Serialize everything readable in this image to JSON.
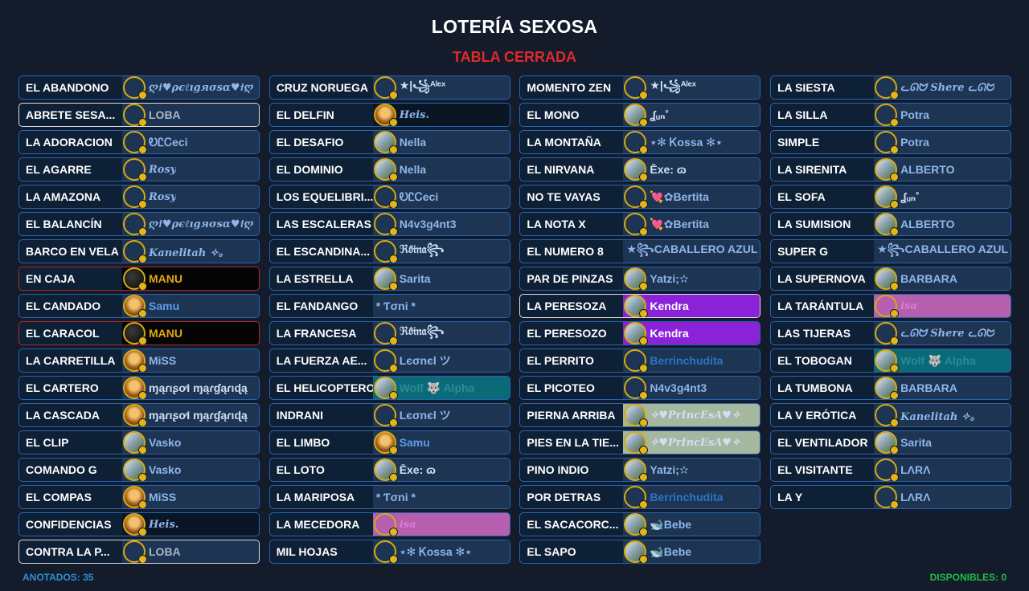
{
  "header": {
    "title": "LOTERÍA SEXOSA",
    "subtitle": "TABLA CERRADA"
  },
  "colors": {
    "accent_red": "#e02a2a",
    "count_blue": "#2d8fd6",
    "count_green": "#1fbf4a",
    "card_border": "#2266b8"
  },
  "columns": [
    [
      {
        "card": "EL ABANDONO",
        "user": "ღϯ♥ρєℓıgяσѕα♥ϯღ",
        "av": "ring",
        "style": "it",
        "bg": "#1d3552",
        "color": "#8fb6ec"
      },
      {
        "card": "ABRETE SESA...",
        "user": "LOBA",
        "av": "ring",
        "border": "white",
        "bg": "#1d3552",
        "color": "#a9b6c8"
      },
      {
        "card": "LA ADORACION",
        "user": "ᎧᏝᏟeci",
        "av": "ring",
        "bg": "#1d3552",
        "color": "#8fb6ec"
      },
      {
        "card": "EL AGARRE",
        "user": "Rosy",
        "av": "ring",
        "style": "it",
        "bg": "#1d3552",
        "color": "#8fb6ec"
      },
      {
        "card": "LA AMAZONA",
        "user": "Rosy",
        "av": "ring",
        "style": "it",
        "bg": "#1d3552",
        "color": "#8fb6ec"
      },
      {
        "card": "EL BALANCÍN",
        "user": "ღϯ♥ρєℓıgяσѕα♥ϯღ",
        "av": "ring",
        "style": "it",
        "bg": "#1d3552",
        "color": "#8fb6ec"
      },
      {
        "card": "BARCO EN VELA",
        "user": "Kanelitah ✧。",
        "av": "ring",
        "style": "it",
        "bg": "#1d3552",
        "color": "#8fb6ec"
      },
      {
        "card": "EN CAJA",
        "user": "MANU",
        "av": "dark",
        "border": "red",
        "bg": "#050505",
        "color": "#e4a712"
      },
      {
        "card": "EL CANDADO",
        "user": "Samu",
        "av": "photo",
        "bg": "#1d3552",
        "color": "#5f9de8"
      },
      {
        "card": "EL CARACOL",
        "user": "MANU",
        "av": "dark",
        "border": "red",
        "bg": "#050505",
        "color": "#e4a712"
      },
      {
        "card": "LA CARRETILLA",
        "user": "MiSS",
        "av": "photo",
        "bg": "#1d3552",
        "color": "#8fb6ec"
      },
      {
        "card": "EL CARTERO",
        "user": "ɱąɾıʂơƖ ɱąɾɠąɾıɖą",
        "av": "photo",
        "bg": "#1d3552",
        "color": "#cfe0f5"
      },
      {
        "card": "LA CASCADA",
        "user": "ɱąɾıʂơƖ ɱąɾɠąɾıɖą",
        "av": "photo",
        "bg": "#1d3552",
        "color": "#cfe0f5"
      },
      {
        "card": "EL CLIP",
        "user": "Vasko",
        "av": "img",
        "bg": "#1d3552",
        "color": "#8fb6ec"
      },
      {
        "card": "COMANDO G",
        "user": "Vasko",
        "av": "img",
        "bg": "#1d3552",
        "color": "#8fb6ec"
      },
      {
        "card": "EL COMPAS",
        "user": "MiSS",
        "av": "photo",
        "bg": "#1d3552",
        "color": "#8fb6ec"
      },
      {
        "card": "CONFIDENCIAS",
        "user": "Heis.",
        "av": "photo",
        "style": "it",
        "bg": "#0a1624",
        "color": "#8fb6ec"
      },
      {
        "card": "CONTRA LA P...",
        "user": "LOBA",
        "av": "ring",
        "border": "white",
        "bg": "#1d3552",
        "color": "#a9b6c8"
      }
    ],
    [
      {
        "card": "CRUZ NORUEGA",
        "user": "★|꧁ᴬˡᵉˣ",
        "av": "ring",
        "bg": "#1d3552",
        "color": "#cfe0f5"
      },
      {
        "card": "EL DELFIN",
        "user": "Heis.",
        "av": "photo",
        "style": "it",
        "bg": "#0a1624",
        "color": "#8fb6ec"
      },
      {
        "card": "EL DESAFIO",
        "user": "Nella",
        "av": "img",
        "bg": "#1d3552",
        "color": "#8fb6ec"
      },
      {
        "card": "EL DOMINIO",
        "user": "Nella",
        "av": "img",
        "bg": "#1d3552",
        "color": "#8fb6ec"
      },
      {
        "card": "LOS EQUELIBRI...",
        "user": "ᎧᏝᏟeci",
        "av": "ring",
        "bg": "#1d3552",
        "color": "#8fb6ec"
      },
      {
        "card": "LAS ESCALERAS",
        "user": "N4v3g4nt3",
        "av": "ring",
        "bg": "#1d3552",
        "color": "#8fb6ec"
      },
      {
        "card": "EL ESCANDINA...",
        "user": "ℜ𝔬̂𝔦𝔫𝔞꧂",
        "av": "ring",
        "bg": "#1d3552",
        "color": "#cfe0f5"
      },
      {
        "card": "LA ESTRELLA",
        "user": "Sarita",
        "av": "img",
        "bg": "#1d3552",
        "color": "#8fb6ec"
      },
      {
        "card": "EL FANDANGO",
        "user": "* Ƭσni *",
        "av": "none",
        "bg": "#1d3552",
        "color": "#8fb6ec"
      },
      {
        "card": "LA FRANCESA",
        "user": "ℜ𝔬̂𝔦𝔫𝔞꧂",
        "av": "ring",
        "bg": "#1d3552",
        "color": "#cfe0f5"
      },
      {
        "card": "LA FUERZA AE...",
        "user": "Lєσnєl    ツ",
        "av": "ring",
        "bg": "#1d3552",
        "color": "#8fb6ec"
      },
      {
        "card": "EL HELICOPTERO",
        "user": "Wolf 🐺 Alpha",
        "av": "img",
        "bg": "#0b6a78",
        "color": "#2a8a97"
      },
      {
        "card": "INDRANI",
        "user": "Lєσnєl    ツ",
        "av": "ring",
        "bg": "#1d3552",
        "color": "#8fb6ec"
      },
      {
        "card": "EL LIMBO",
        "user": "Samu",
        "av": "photo",
        "bg": "#1d3552",
        "color": "#5f9de8"
      },
      {
        "card": "EL LOTO",
        "user": "Ēxe: ɷ",
        "av": "img",
        "bg": "#1d3552",
        "color": "#cfe0f5"
      },
      {
        "card": "LA MARIPOSA",
        "user": "* Ƭσni *",
        "av": "none",
        "bg": "#1d3552",
        "color": "#8fb6ec"
      },
      {
        "card": "LA MECEDORA",
        "user": "isa",
        "av": "ring",
        "style": "it",
        "bg": "#b65fae",
        "color": "#e07ad6"
      },
      {
        "card": "MIL HOJAS",
        "user": "⋆✻ Ꮶossa ✻⋆",
        "av": "ring",
        "bg": "#1d3552",
        "color": "#8fb6ec"
      }
    ],
    [
      {
        "card": "MOMENTO ZEN",
        "user": "★|꧁ᴬˡᵉˣ",
        "av": "ring",
        "bg": "#1d3552",
        "color": "#cfe0f5"
      },
      {
        "card": "EL MONO",
        "user": "ʆᵤₙ˚",
        "av": "img",
        "bg": "#1d3552",
        "color": "#cfe0f5"
      },
      {
        "card": "LA MONTAÑA",
        "user": "⋆✻ Ꮶossa ✻⋆",
        "av": "ring",
        "bg": "#1d3552",
        "color": "#8fb6ec"
      },
      {
        "card": "EL NIRVANA",
        "user": "Ēxe: ɷ",
        "av": "img",
        "bg": "#1d3552",
        "color": "#cfe0f5"
      },
      {
        "card": "NO TE VAYAS",
        "user": "💘✿Bertita",
        "av": "ring",
        "bg": "#1d3552",
        "color": "#8fb6ec"
      },
      {
        "card": "LA NOTA X",
        "user": "💘✿Bertita",
        "av": "ring",
        "bg": "#1d3552",
        "color": "#8fb6ec"
      },
      {
        "card": "EL NUMERO 8",
        "user": "★꧂CABALLERO AZUL",
        "av": "none",
        "bg": "#1d3552",
        "color": "#8fb6ec"
      },
      {
        "card": "PAR DE PINZAS",
        "user": "Yatzi;✫",
        "av": "img",
        "bg": "#1d3552",
        "color": "#8fb6ec"
      },
      {
        "card": "LA PERESOZA",
        "user": "Kendra",
        "av": "img",
        "border": "white",
        "bg": "#8a22d8",
        "color": "#ffffff"
      },
      {
        "card": "EL PERESOZO",
        "user": "Kendra",
        "av": "img",
        "bg": "#8a22d8",
        "color": "#ffffff"
      },
      {
        "card": "EL PERRITO",
        "user": "Berrinchudita",
        "av": "ring",
        "bg": "#1d3552",
        "color": "#2d73c8"
      },
      {
        "card": "EL PICOTEO",
        "user": "N4v3g4nt3",
        "av": "ring",
        "bg": "#1d3552",
        "color": "#8fb6ec"
      },
      {
        "card": "PIERNA ARRIBA",
        "user": "✧♥PrIncEsA♥✧",
        "av": "img",
        "style": "it",
        "bg": "#a6b7a0",
        "color": "#cfe0f5"
      },
      {
        "card": "PIES EN LA TIE...",
        "user": "✧♥PrIncEsA♥✧",
        "av": "img",
        "style": "it",
        "bg": "#a6b7a0",
        "color": "#cfe0f5"
      },
      {
        "card": "PINO INDIO",
        "user": "Yatzi;✫",
        "av": "img",
        "bg": "#1d3552",
        "color": "#8fb6ec"
      },
      {
        "card": "POR DETRAS",
        "user": "Berrinchudita",
        "av": "ring",
        "bg": "#1d3552",
        "color": "#2d73c8"
      },
      {
        "card": "EL SACACORC...",
        "user": "🐋Bebe",
        "av": "img",
        "bg": "#1d3552",
        "color": "#8fb6ec"
      },
      {
        "card": "EL SAPO",
        "user": "🐋Bebe",
        "av": "img",
        "bg": "#1d3552",
        "color": "#8fb6ec"
      }
    ],
    [
      {
        "card": "LA SIESTA",
        "user": "ᓚᘏᗢ Shere ᓚᘏᗢ",
        "av": "ring",
        "style": "it",
        "bg": "#1d3552",
        "color": "#8fb6ec"
      },
      {
        "card": "LA SILLA",
        "user": "Potra",
        "av": "ring",
        "bg": "#1d3552",
        "color": "#8fb6ec"
      },
      {
        "card": "SIMPLE",
        "user": "Potra",
        "av": "ring",
        "bg": "#1d3552",
        "color": "#8fb6ec"
      },
      {
        "card": "LA SIRENITA",
        "user": "ALBERTO",
        "av": "img",
        "bg": "#1d3552",
        "color": "#8fb6ec"
      },
      {
        "card": "EL SOFA",
        "user": "ʆᵤₙ˚",
        "av": "img",
        "bg": "#1d3552",
        "color": "#cfe0f5"
      },
      {
        "card": "LA SUMISION",
        "user": "ALBERTO",
        "av": "img",
        "bg": "#1d3552",
        "color": "#8fb6ec"
      },
      {
        "card": "SUPER G",
        "user": "★꧂CABALLERO AZUL",
        "av": "none",
        "bg": "#1d3552",
        "color": "#8fb6ec"
      },
      {
        "card": "LA SUPERNOVA",
        "user": "BARBARA",
        "av": "img",
        "bg": "#1d3552",
        "color": "#8fb6ec"
      },
      {
        "card": "LA TARÁNTULA",
        "user": "isa",
        "av": "ring",
        "style": "it",
        "bg": "#b65fae",
        "color": "#e07ad6"
      },
      {
        "card": "LAS TIJERAS",
        "user": "ᓚᘏᗢ Shere ᓚᘏᗢ",
        "av": "ring",
        "style": "it",
        "bg": "#1d3552",
        "color": "#8fb6ec"
      },
      {
        "card": "EL TOBOGAN",
        "user": "Wolf 🐺 Alpha",
        "av": "img",
        "bg": "#0b6a78",
        "color": "#2a8a97"
      },
      {
        "card": "LA TUMBONA",
        "user": "BARBARA",
        "av": "img",
        "bg": "#1d3552",
        "color": "#8fb6ec"
      },
      {
        "card": "LA V ERÓTICA",
        "user": "Kanelitah ✧。",
        "av": "ring",
        "style": "it",
        "bg": "#1d3552",
        "color": "#8fb6ec"
      },
      {
        "card": "EL VENTILADOR",
        "user": "Sarita",
        "av": "img",
        "bg": "#1d3552",
        "color": "#8fb6ec"
      },
      {
        "card": "EL VISITANTE",
        "user": "LΛRΛ",
        "av": "ring",
        "bg": "#1d3552",
        "color": "#8fb6ec"
      },
      {
        "card": "LA Y",
        "user": "LΛRΛ",
        "av": "ring",
        "bg": "#1d3552",
        "color": "#8fb6ec"
      }
    ]
  ],
  "footer": {
    "anotados": "ANOTADOS: 35",
    "disponibles": "DISPONIBLES: 0"
  }
}
